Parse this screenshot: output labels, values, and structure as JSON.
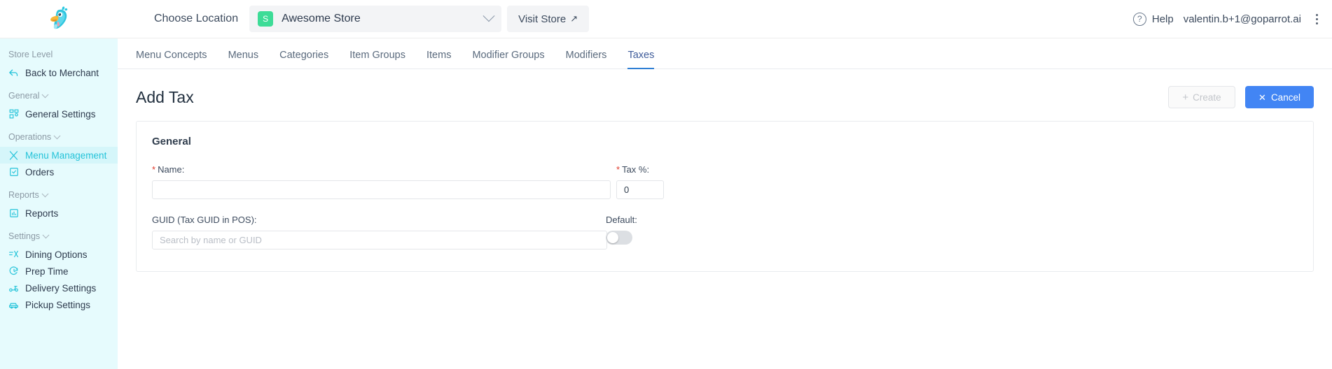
{
  "header": {
    "choose_location_label": "Choose Location",
    "store_badge": "S",
    "store_name": "Awesome Store",
    "visit_store_label": "Visit Store",
    "visit_store_arrow": "↗",
    "help_label": "Help",
    "help_icon_glyph": "?",
    "user_email": "valentin.b+1@goparrot.ai"
  },
  "sidebar": {
    "sections": [
      {
        "label": "Store Level",
        "collapsible": false,
        "items": [
          {
            "label": "Back to Merchant",
            "icon": "back-arrow-icon",
            "active": false
          }
        ]
      },
      {
        "label": "General",
        "collapsible": true,
        "items": [
          {
            "label": "General Settings",
            "icon": "grid-squares-icon",
            "active": false
          }
        ]
      },
      {
        "label": "Operations",
        "collapsible": true,
        "items": [
          {
            "label": "Menu Management",
            "icon": "fork-spoon-icon",
            "active": true
          },
          {
            "label": "Orders",
            "icon": "clipboard-check-icon",
            "active": false
          }
        ]
      },
      {
        "label": "Reports",
        "collapsible": true,
        "items": [
          {
            "label": "Reports",
            "icon": "bar-chart-icon",
            "active": false
          }
        ]
      },
      {
        "label": "Settings",
        "collapsible": true,
        "items": [
          {
            "label": "Dining Options",
            "icon": "dining-options-icon",
            "active": false
          },
          {
            "label": "Prep Time",
            "icon": "clock-icon",
            "active": false
          },
          {
            "label": "Delivery Settings",
            "icon": "scooter-icon",
            "active": false
          },
          {
            "label": "Pickup Settings",
            "icon": "car-pickup-icon",
            "active": false
          }
        ]
      }
    ]
  },
  "main": {
    "tabs": [
      {
        "label": "Menu Concepts",
        "active": false
      },
      {
        "label": "Menus",
        "active": false
      },
      {
        "label": "Categories",
        "active": false
      },
      {
        "label": "Item Groups",
        "active": false
      },
      {
        "label": "Items",
        "active": false
      },
      {
        "label": "Modifier Groups",
        "active": false
      },
      {
        "label": "Modifiers",
        "active": false
      },
      {
        "label": "Taxes",
        "active": true
      }
    ],
    "page_title": "Add Tax",
    "create_label": "Create",
    "create_icon": "+",
    "cancel_label": "Cancel",
    "cancel_icon": "✕",
    "card": {
      "title": "General",
      "name_label": "Name:",
      "name_required_mark": "*",
      "name_value": "",
      "name_placeholder": "",
      "tax_label": "Tax %:",
      "tax_required_mark": "*",
      "tax_value": "0",
      "guid_label": "GUID (Tax GUID in POS):",
      "guid_value": "",
      "guid_placeholder": "Search by name or GUID",
      "default_label": "Default:",
      "default_on": false
    }
  },
  "colors": {
    "sidebar_bg": "#e6fbfd",
    "sidebar_active_bg": "#d5f6fa",
    "accent_cyan": "#24c3d9",
    "primary_blue": "#4285f4",
    "tab_active_underline": "#2f7fd4",
    "store_badge_green": "#3ddc97",
    "required_red": "#e0392b"
  }
}
